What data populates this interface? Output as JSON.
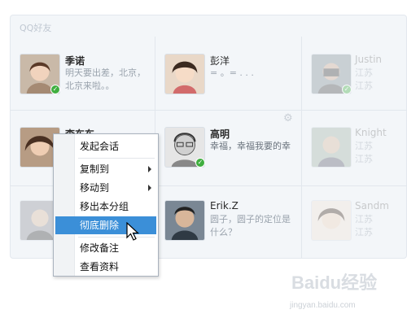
{
  "panel": {
    "title": "QQ好友"
  },
  "contacts": [
    {
      "name": "季诺",
      "signature_line1": "明天要出差，北京，",
      "signature_line2": "北京来啦。。"
    },
    {
      "name": "彭洋",
      "signature_line1": "= 。= . . ."
    },
    {
      "name": "Justin",
      "signature_line1": "江苏",
      "signature_line2": "江苏"
    },
    {
      "name": "李东东",
      "signature_line1": ""
    },
    {
      "name": "高明",
      "signature_line1": "幸福，幸福我要的幸"
    },
    {
      "name": "Knight",
      "signature_line1": "江苏",
      "signature_line2": "江苏"
    },
    {
      "name": "",
      "signature_line1": ""
    },
    {
      "name": "Erik.Z",
      "signature_line1": "圆子，圆子的定位是",
      "signature_line2": "什么？"
    },
    {
      "name": "Sandm",
      "signature_line1": "江苏",
      "signature_line2": "江苏"
    }
  ],
  "context_menu": {
    "items": [
      {
        "label": "发起会话",
        "submenu": false
      },
      {
        "label": "复制到",
        "submenu": true
      },
      {
        "label": "移动到",
        "submenu": true
      },
      {
        "label": "移出本分组",
        "submenu": false
      },
      {
        "label": "彻底删除",
        "submenu": false,
        "active": true
      },
      {
        "label": "修改备注",
        "submenu": false
      },
      {
        "label": "查看资料",
        "submenu": false
      }
    ]
  },
  "watermark": {
    "logo": "Baidu经验",
    "url": "jingyan.baidu.com"
  },
  "colors": {
    "highlight": "#3b8fd8",
    "online": "#3fae3f"
  }
}
